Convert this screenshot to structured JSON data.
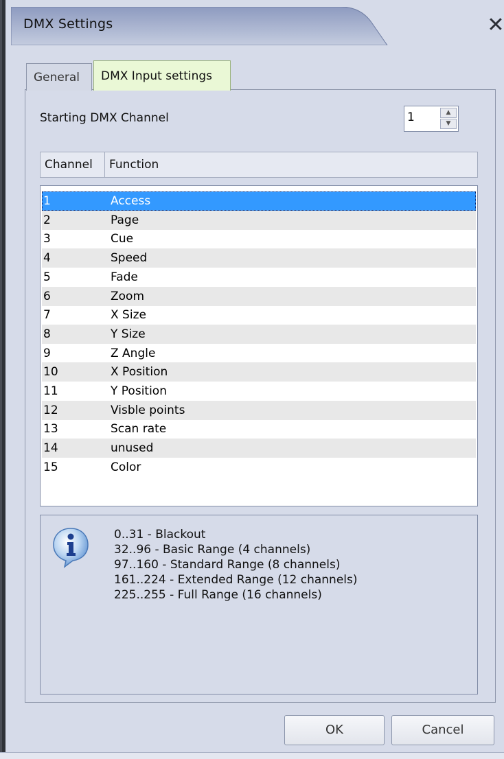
{
  "window": {
    "title": "DMX Settings",
    "close_symbol": "✕"
  },
  "tabs": [
    {
      "label": "General",
      "active": false
    },
    {
      "label": "DMX Input settings",
      "active": true
    }
  ],
  "starting_channel": {
    "label": "Starting DMX Channel",
    "value": "1"
  },
  "table": {
    "headers": {
      "channel": "Channel",
      "function": "Function"
    },
    "rows": [
      {
        "channel": "1",
        "function": "Access",
        "selected": true
      },
      {
        "channel": "2",
        "function": "Page"
      },
      {
        "channel": "3",
        "function": "Cue"
      },
      {
        "channel": "4",
        "function": "Speed"
      },
      {
        "channel": "5",
        "function": "Fade"
      },
      {
        "channel": "6",
        "function": "Zoom"
      },
      {
        "channel": "7",
        "function": "X Size"
      },
      {
        "channel": "8",
        "function": "Y Size"
      },
      {
        "channel": "9",
        "function": "Z Angle"
      },
      {
        "channel": "10",
        "function": "X Position"
      },
      {
        "channel": "11",
        "function": "Y Position"
      },
      {
        "channel": "12",
        "function": "Visble points"
      },
      {
        "channel": "13",
        "function": "Scan rate"
      },
      {
        "channel": "14",
        "function": "unused"
      },
      {
        "channel": "15",
        "function": "Color"
      }
    ]
  },
  "info": {
    "icon": "info-icon",
    "lines": [
      "0..31 - Blackout",
      "32..96 - Basic Range (4 channels)",
      "97..160 - Standard Range (8 channels)",
      "161..224 - Extended Range (12 channels)",
      "225..255 - Full Range (16 channels)"
    ]
  },
  "buttons": {
    "ok": "OK",
    "cancel": "Cancel"
  },
  "colors": {
    "window_bg": "#d6dbe9",
    "selection": "#3399ff",
    "active_tab": "#eaf8d6"
  }
}
